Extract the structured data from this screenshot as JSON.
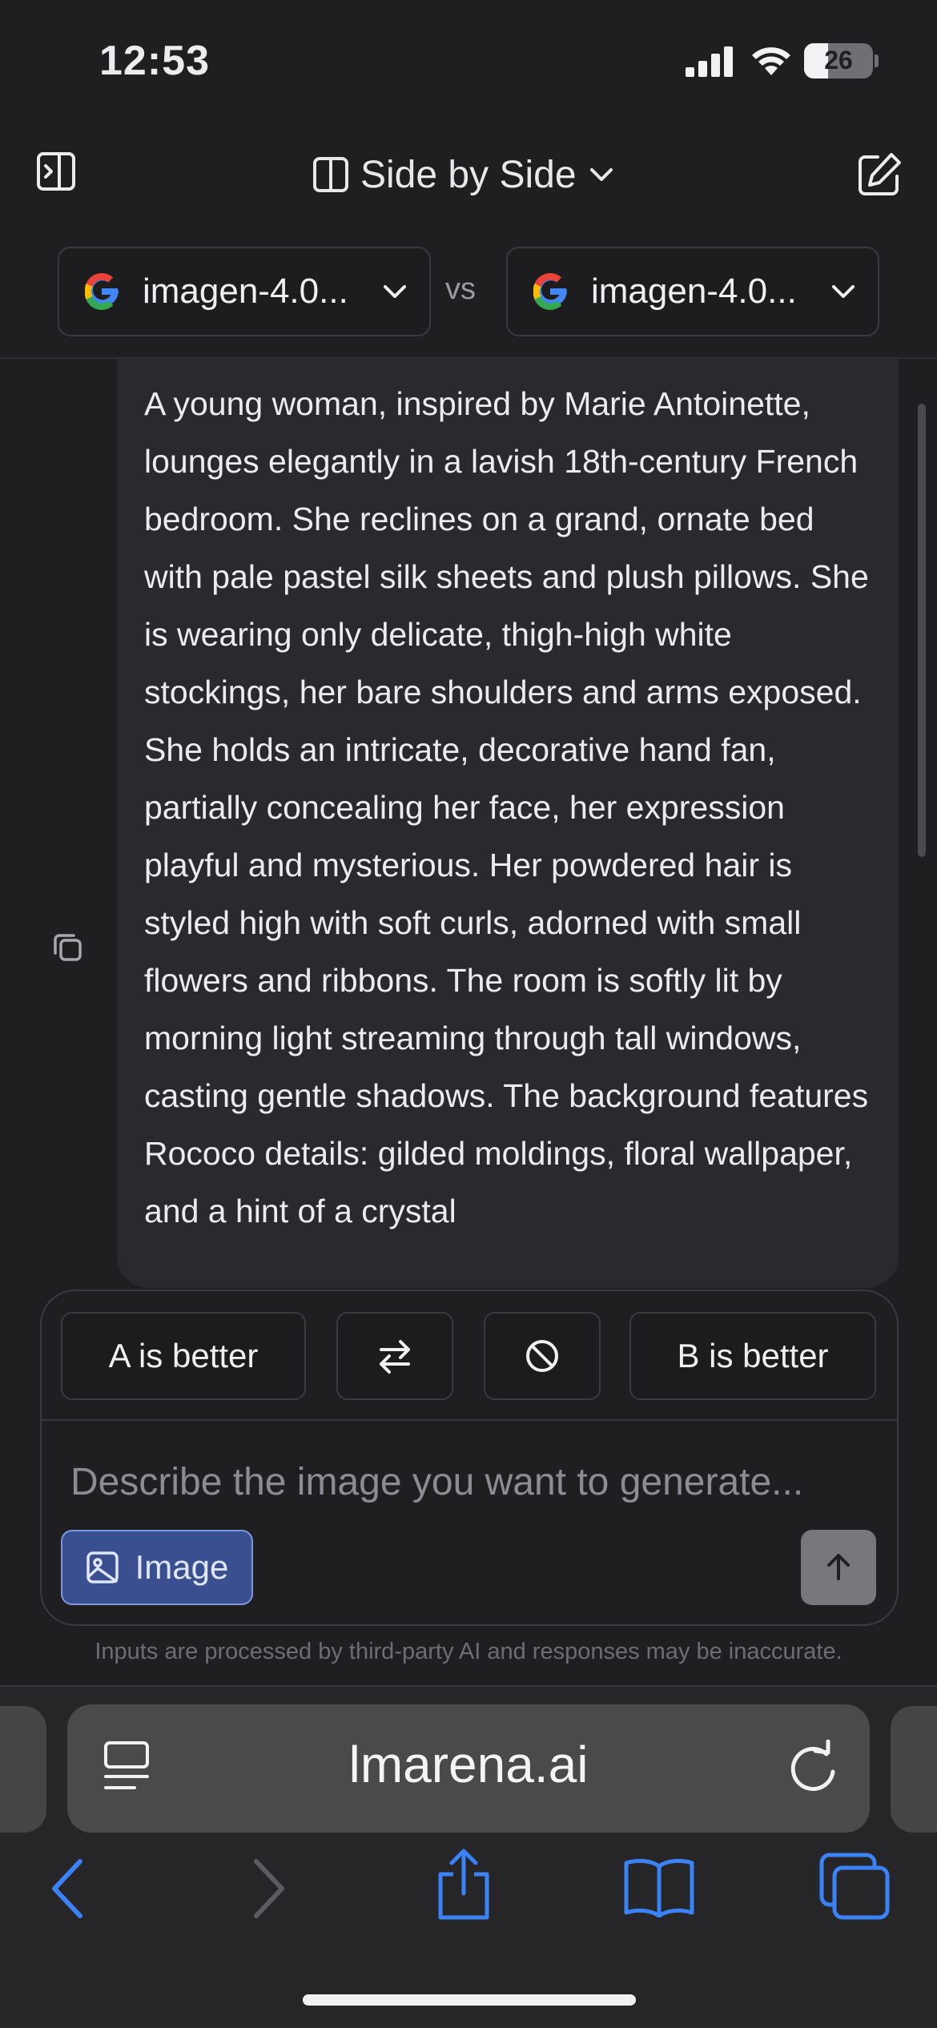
{
  "status_bar": {
    "time": "12:53",
    "battery": "26"
  },
  "header": {
    "mode_title": "Side by Side"
  },
  "models": {
    "a": {
      "name": "imagen-4.0...",
      "icon": "google-icon"
    },
    "vs": "vs",
    "b": {
      "name": "imagen-4.0...",
      "icon": "google-icon"
    }
  },
  "prompt": {
    "text": "A young woman, inspired by Marie Antoinette, lounges elegantly in a lavish 18th-century French bedroom. She reclines on a grand, ornate bed with pale pastel silk sheets and plush pillows. She is wearing only delicate, thigh-high white stockings, her bare shoulders and arms exposed. She holds an intricate, decorative hand fan, partially concealing her face, her expression playful and mysterious. Her powdered hair is styled high with soft curls, adorned with small flowers and ribbons. The room is softly lit by morning light streaming through tall windows, casting gentle shadows. The background features Rococo details: gilded moldings, floral wallpaper, and a hint of a crystal"
  },
  "vote": {
    "a_better": "A is better",
    "b_better": "B is better"
  },
  "composer": {
    "placeholder": "Describe the image you want to generate...",
    "image_label": "Image"
  },
  "disclaimer": "Inputs are processed by third-party AI and responses may be inaccurate.",
  "browser": {
    "url": "lmarena.ai"
  },
  "colors": {
    "accent": "#3a4f8f",
    "background": "#1f1f22",
    "safari_blue": "#3b82f6"
  }
}
